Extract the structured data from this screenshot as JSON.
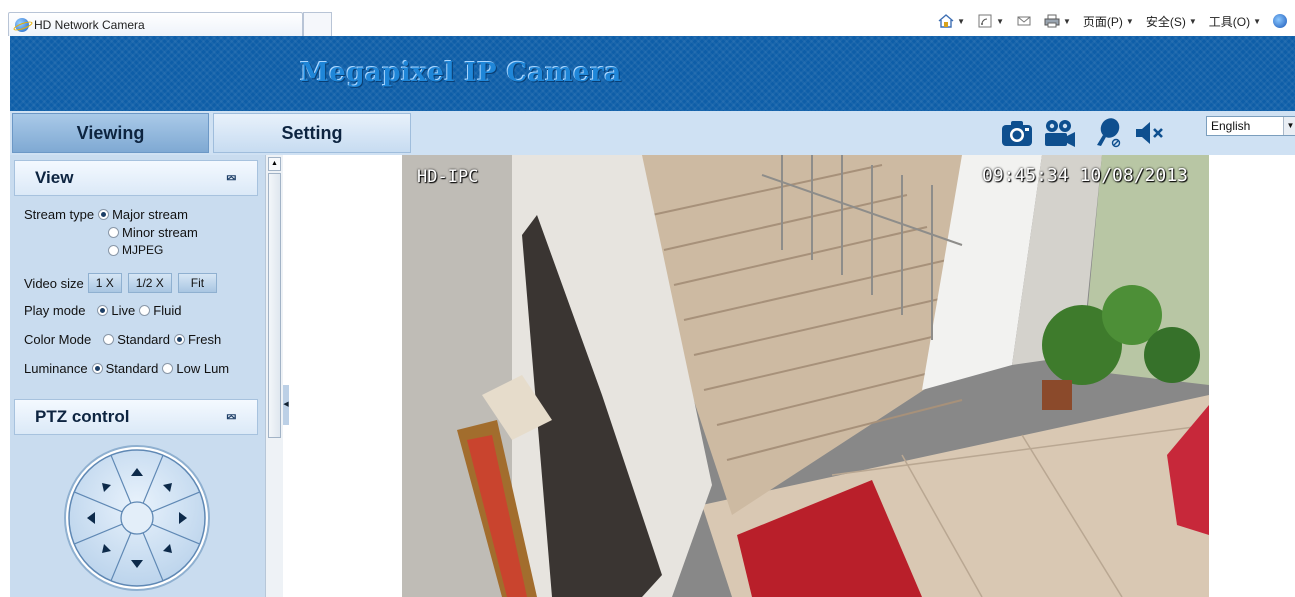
{
  "browser": {
    "tab_title": "HD Network Camera",
    "commands": {
      "page": "页面(P)",
      "safety": "安全(S)",
      "tools": "工具(O)"
    }
  },
  "header": {
    "title": "Megapixel IP Camera"
  },
  "nav": {
    "viewing": "Viewing",
    "setting": "Setting"
  },
  "toolbar": {
    "icons": [
      "snapshot-icon",
      "record-icon",
      "talk-icon",
      "mute-icon"
    ],
    "language": "English"
  },
  "view_panel": {
    "title": "View",
    "stream_type": {
      "label": "Stream type",
      "options": [
        "Major stream",
        "Minor stream",
        "MJPEG"
      ],
      "selected": "Major stream"
    },
    "video_size": {
      "label": "Video size",
      "buttons": [
        "1 X",
        "1/2 X",
        "Fit"
      ]
    },
    "play_mode": {
      "label": "Play mode",
      "options": [
        "Live",
        "Fluid"
      ],
      "selected": "Live"
    },
    "color_mode": {
      "label": "Color Mode",
      "options": [
        "Standard",
        "Fresh"
      ],
      "selected": "Fresh"
    },
    "luminance": {
      "label": "Luminance",
      "options": [
        "Standard",
        "Low Lum"
      ],
      "selected": "Standard"
    }
  },
  "ptz_panel": {
    "title": "PTZ control"
  },
  "video": {
    "osd_name": "HD-IPC",
    "osd_datetime": "09:45:34 10/08/2013"
  },
  "colors": {
    "banner": "#0e5ea8",
    "panel": "#c9dcef",
    "nav_active": "#7fa9d3"
  }
}
